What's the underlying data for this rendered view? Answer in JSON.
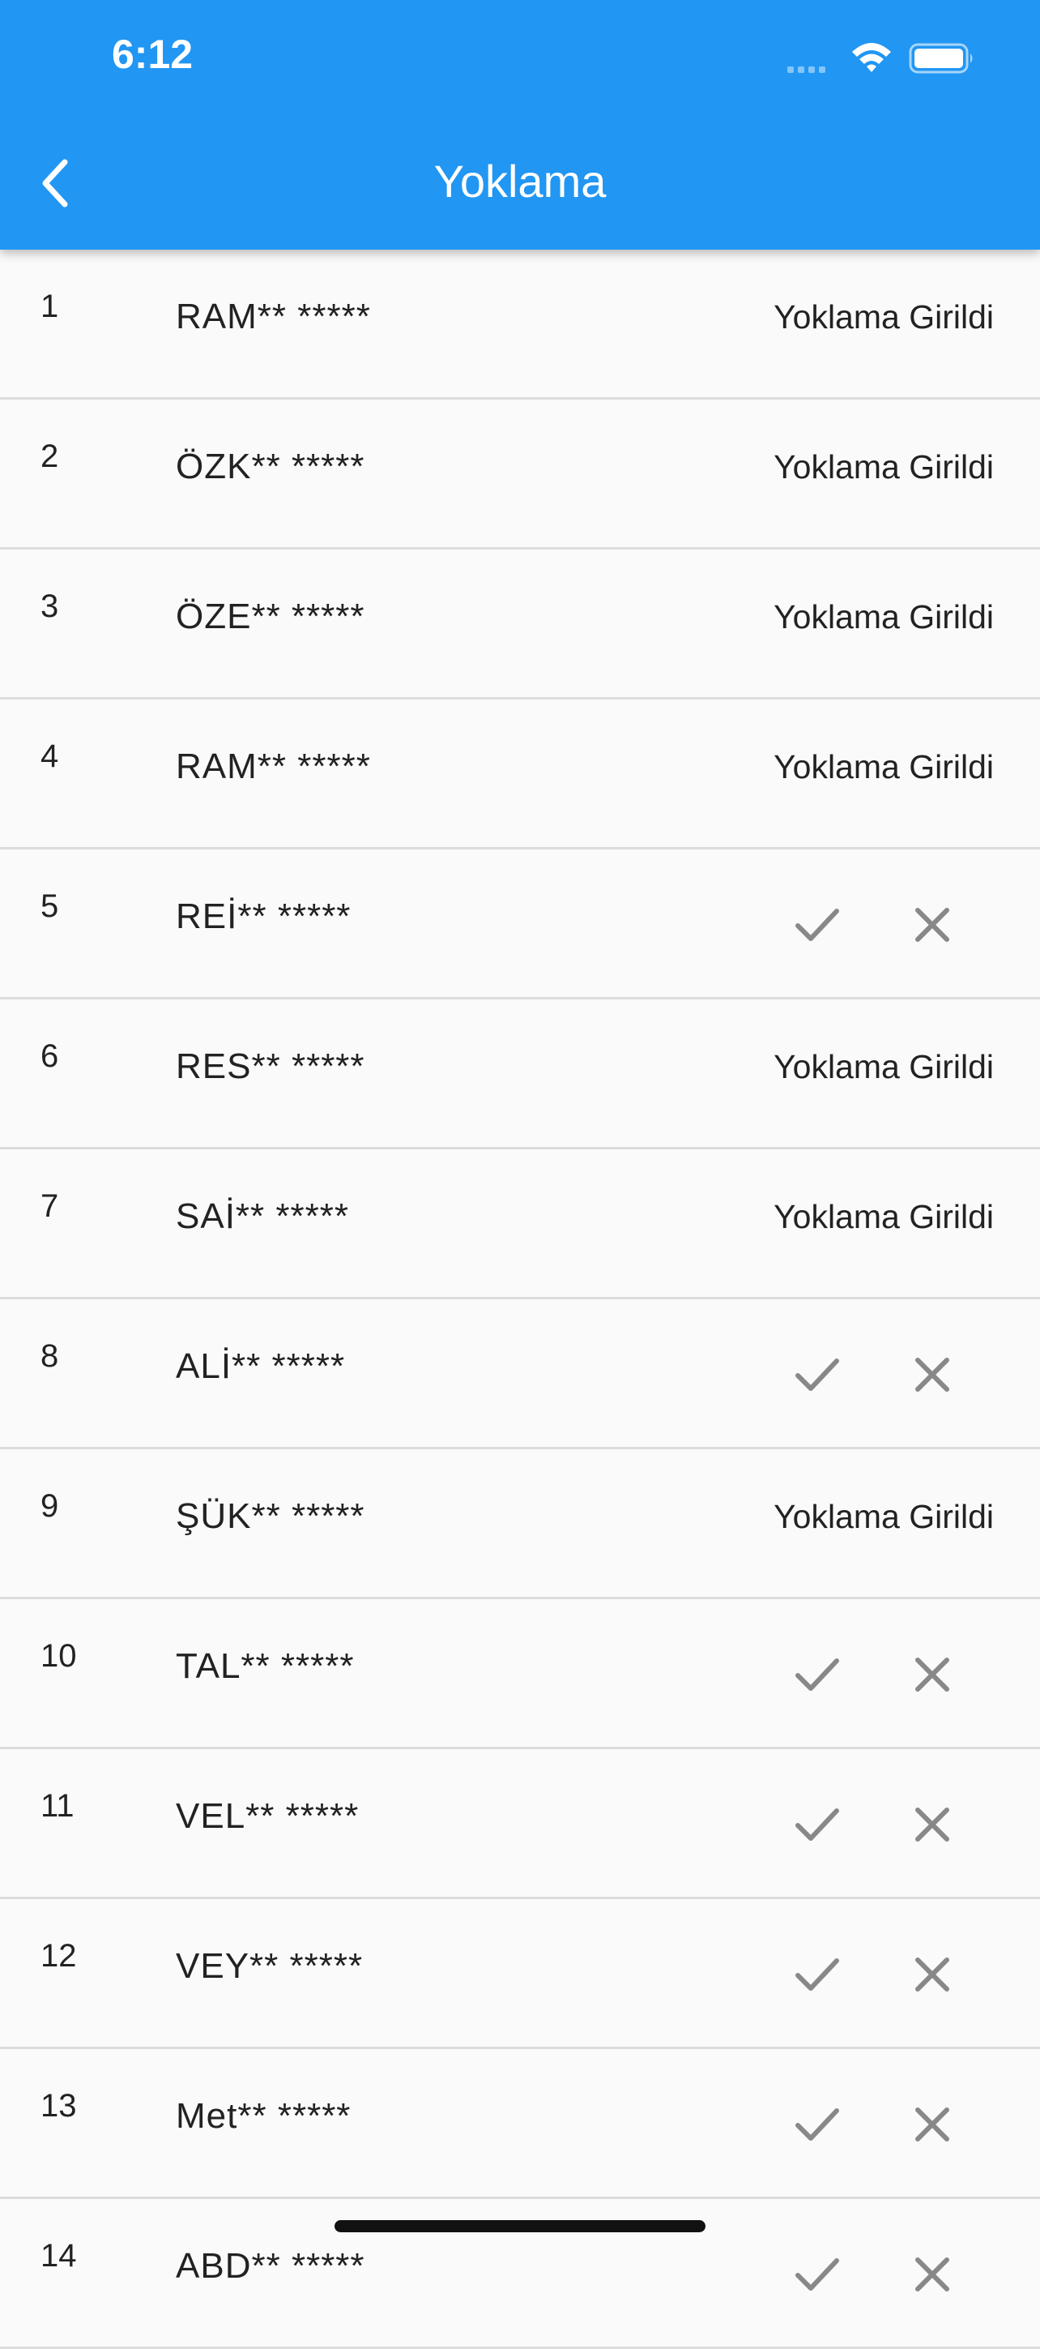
{
  "status_bar": {
    "time": "6:12"
  },
  "header": {
    "title": "Yoklama",
    "back_icon": "chevron-left-icon"
  },
  "colors": {
    "app_bar": "#2196F3",
    "background": "#fafafa",
    "divider": "#dcdcdc",
    "action_icon": "#888888"
  },
  "students": [
    {
      "no": "1",
      "name": "RAM** *****",
      "status": "Yoklama Girildi"
    },
    {
      "no": "2",
      "name": "ÖZK** *****",
      "status": "Yoklama Girildi"
    },
    {
      "no": "3",
      "name": "ÖZE** *****",
      "status": "Yoklama Girildi"
    },
    {
      "no": "4",
      "name": "RAM** *****",
      "status": "Yoklama Girildi"
    },
    {
      "no": "5",
      "name": "REİ** *****",
      "status": null
    },
    {
      "no": "6",
      "name": "RES** *****",
      "status": "Yoklama Girildi"
    },
    {
      "no": "7",
      "name": "SAİ** *****",
      "status": "Yoklama Girildi"
    },
    {
      "no": "8",
      "name": "ALİ** *****",
      "status": null
    },
    {
      "no": "9",
      "name": "ŞÜK** *****",
      "status": "Yoklama Girildi"
    },
    {
      "no": "10",
      "name": "TAL** *****",
      "status": null
    },
    {
      "no": "11",
      "name": "VEL** *****",
      "status": null
    },
    {
      "no": "12",
      "name": "VEY** *****",
      "status": null
    },
    {
      "no": "13",
      "name": "Met** *****",
      "status": null
    },
    {
      "no": "14",
      "name": "ABD** *****",
      "status": null
    }
  ]
}
